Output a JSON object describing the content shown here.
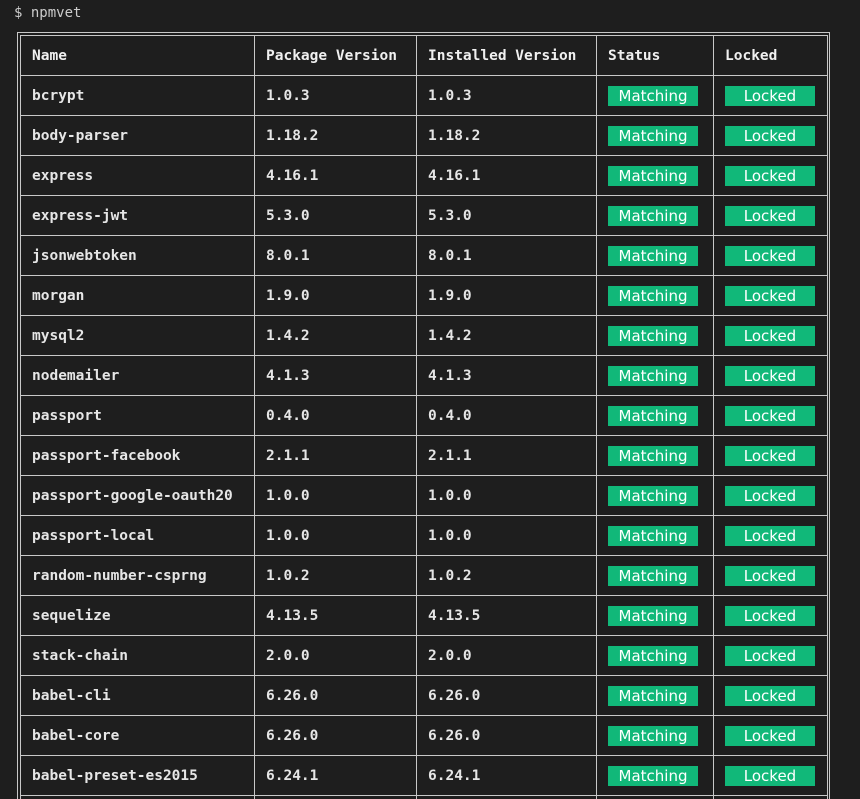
{
  "terminal": {
    "prompt": "$ npmvet"
  },
  "table": {
    "headers": [
      "Name",
      "Package Version",
      "Installed Version",
      "Status",
      "Locked"
    ],
    "rows": [
      {
        "name": "bcrypt",
        "package_version": "1.0.3",
        "installed_version": "1.0.3",
        "status": "Matching",
        "locked": "Locked"
      },
      {
        "name": "body-parser",
        "package_version": "1.18.2",
        "installed_version": "1.18.2",
        "status": "Matching",
        "locked": "Locked"
      },
      {
        "name": "express",
        "package_version": "4.16.1",
        "installed_version": "4.16.1",
        "status": "Matching",
        "locked": "Locked"
      },
      {
        "name": "express-jwt",
        "package_version": "5.3.0",
        "installed_version": "5.3.0",
        "status": "Matching",
        "locked": "Locked"
      },
      {
        "name": "jsonwebtoken",
        "package_version": "8.0.1",
        "installed_version": "8.0.1",
        "status": "Matching",
        "locked": "Locked"
      },
      {
        "name": "morgan",
        "package_version": "1.9.0",
        "installed_version": "1.9.0",
        "status": "Matching",
        "locked": "Locked"
      },
      {
        "name": "mysql2",
        "package_version": "1.4.2",
        "installed_version": "1.4.2",
        "status": "Matching",
        "locked": "Locked"
      },
      {
        "name": "nodemailer",
        "package_version": "4.1.3",
        "installed_version": "4.1.3",
        "status": "Matching",
        "locked": "Locked"
      },
      {
        "name": "passport",
        "package_version": "0.4.0",
        "installed_version": "0.4.0",
        "status": "Matching",
        "locked": "Locked"
      },
      {
        "name": "passport-facebook",
        "package_version": "2.1.1",
        "installed_version": "2.1.1",
        "status": "Matching",
        "locked": "Locked"
      },
      {
        "name": "passport-google-oauth20",
        "package_version": "1.0.0",
        "installed_version": "1.0.0",
        "status": "Matching",
        "locked": "Locked"
      },
      {
        "name": "passport-local",
        "package_version": "1.0.0",
        "installed_version": "1.0.0",
        "status": "Matching",
        "locked": "Locked"
      },
      {
        "name": "random-number-csprng",
        "package_version": "1.0.2",
        "installed_version": "1.0.2",
        "status": "Matching",
        "locked": "Locked"
      },
      {
        "name": "sequelize",
        "package_version": "4.13.5",
        "installed_version": "4.13.5",
        "status": "Matching",
        "locked": "Locked"
      },
      {
        "name": "stack-chain",
        "package_version": "2.0.0",
        "installed_version": "2.0.0",
        "status": "Matching",
        "locked": "Locked"
      },
      {
        "name": "babel-cli",
        "package_version": "6.26.0",
        "installed_version": "6.26.0",
        "status": "Matching",
        "locked": "Locked"
      },
      {
        "name": "babel-core",
        "package_version": "6.26.0",
        "installed_version": "6.26.0",
        "status": "Matching",
        "locked": "Locked"
      },
      {
        "name": "babel-preset-es2015",
        "package_version": "6.24.1",
        "installed_version": "6.24.1",
        "status": "Matching",
        "locked": "Locked"
      },
      {
        "name": "",
        "package_version": "",
        "installed_version": "",
        "status": "",
        "locked": ""
      }
    ]
  },
  "colors": {
    "background": "#1e1e1e",
    "badge": "#11b879",
    "border": "#c8c8c8"
  }
}
